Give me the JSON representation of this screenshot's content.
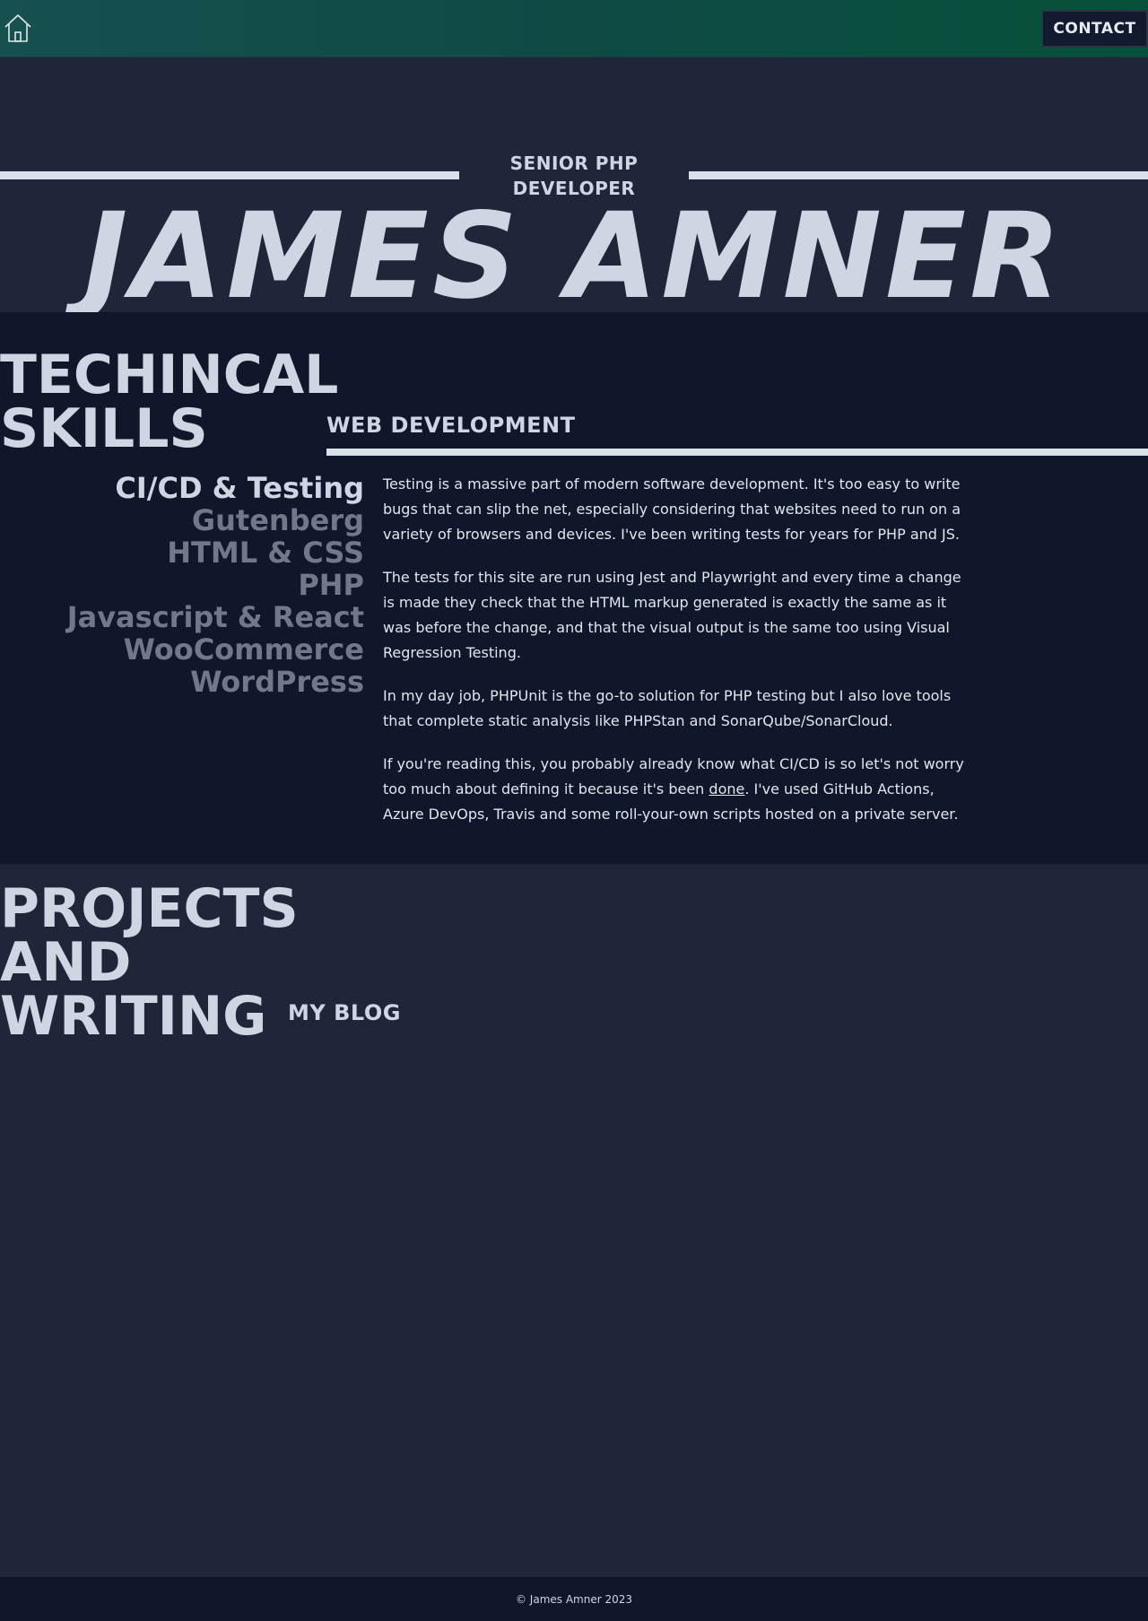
{
  "header": {
    "home_icon": "home-icon",
    "contact_label": "CONTACT"
  },
  "hero": {
    "subtitle_line1": "SENIOR PHP",
    "subtitle_line2": "DEVELOPER",
    "name": "JAMES AMNER"
  },
  "skills": {
    "heading_line1": "TECHINCAL",
    "heading_line2": "SKILLS",
    "section_label": "WEB DEVELOPMENT",
    "items": [
      {
        "label": "CI/CD & Testing"
      },
      {
        "label": "Gutenberg"
      },
      {
        "label": "HTML & CSS"
      },
      {
        "label": "PHP"
      },
      {
        "label": "Javascript & React"
      },
      {
        "label": "WooCommerce"
      },
      {
        "label": "WordPress"
      }
    ],
    "active_index": 0,
    "paragraphs": [
      "Testing is a massive part of modern software development. It's too easy to write bugs that can slip the net, especially considering that websites need to run on a variety of browsers and devices. I've been writing tests for years for PHP and JS.",
      "The tests for this site are run using Jest and Playwright and every time a change is made they check that the HTML markup generated is exactly the same as it was before the change, and that the visual output is the same too using Visual Regression Testing.",
      "In my day job, PHPUnit is the go-to solution for PHP testing but I also love tools that complete static analysis like PHPStan and SonarQube/SonarCloud."
    ],
    "last_paragraph": {
      "before_link": "If you're reading this, you probably already know what CI/CD is so let's not worry too much about defining it because it's been ",
      "link_text": "done",
      "after_link": ". I've used GitHub Actions, Azure DevOps, Travis and some roll-your-own scripts hosted on a private server."
    }
  },
  "projects": {
    "heading_line1": "PROJECTS",
    "heading_line2": "AND",
    "heading_line3": "WRITING",
    "blog_label": "MY BLOG"
  },
  "footer": {
    "copyright": "© James Amner 2023"
  },
  "colors": {
    "topbar_start": "#16504f",
    "topbar_end": "#06513a",
    "background": "#1e273a",
    "section_dark": "#0f172a",
    "text": "#cdd6e2",
    "muted": "#70798a"
  }
}
